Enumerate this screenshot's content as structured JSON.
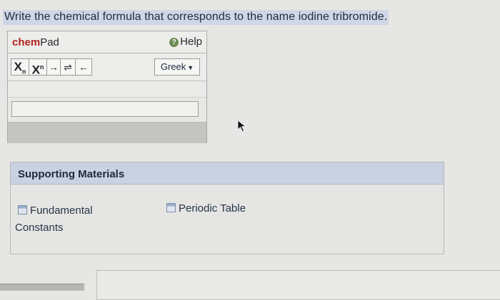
{
  "question": "Write the chemical formula that corresponds to the name iodine tribromide.",
  "chempad": {
    "title_bold": "chem",
    "title_rest": "Pad",
    "help_label": "Help",
    "toolbar": {
      "subscript": "X",
      "subscript_mark": "n",
      "superscript": "X",
      "superscript_mark": "n",
      "arrow": "→",
      "equilibrium": "⇌",
      "backspace": "←"
    },
    "greek_label": "Greek",
    "input_value": ""
  },
  "supporting": {
    "heading": "Supporting Materials",
    "links": [
      {
        "label": "Fundamental\nConstants"
      },
      {
        "label": "Periodic Table"
      }
    ]
  }
}
